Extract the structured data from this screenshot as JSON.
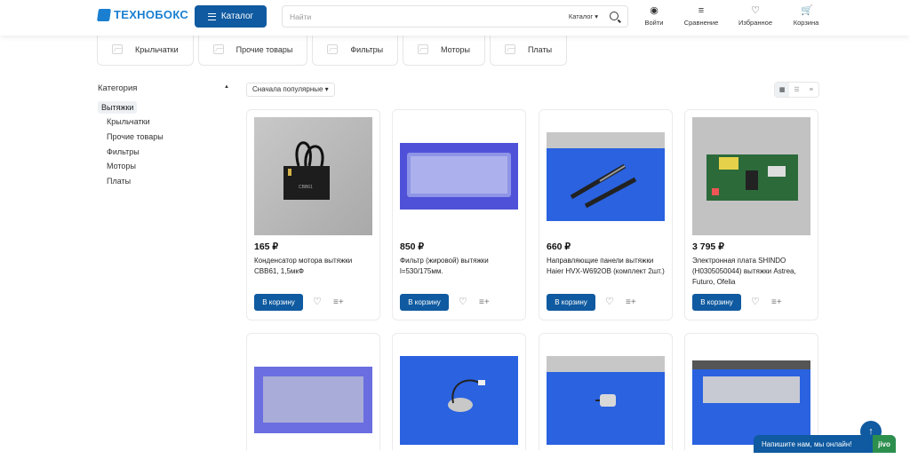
{
  "header": {
    "logo": "ТЕХНОБОКС",
    "catalog_button": "Каталог",
    "search_placeholder": "Найти",
    "search_scope": "Каталог",
    "login": "Войти",
    "compare": "Сравнение",
    "favorites": "Избранное",
    "cart": "Корзина"
  },
  "chips": [
    "Крыльчатки",
    "Прочие товары",
    "Фильтры",
    "Моторы",
    "Платы"
  ],
  "sidebar": {
    "title": "Категория",
    "active": "Вытяжки",
    "items": [
      "Крыльчатки",
      "Прочие товары",
      "Фильтры",
      "Моторы",
      "Платы"
    ]
  },
  "sort": {
    "label": "Сначала популярные"
  },
  "products": [
    {
      "price": "165 ₽",
      "title": "Конденсатор мотора вытяжки CBB61, 1,5мкФ",
      "buy": "В корзину"
    },
    {
      "price": "850 ₽",
      "title": "Фильтр (жировой) вытяжки l=530/175мм.",
      "buy": "В корзину"
    },
    {
      "price": "660 ₽",
      "title": "Направляющие панели вытяжки Haier HVX-W692OB (комплект 2шт.)",
      "buy": "В корзину"
    },
    {
      "price": "3 795 ₽",
      "title": "Электронная плата SHINDO (H0305050044) вытяжки Astrea, Futuro, Ofelia",
      "buy": "В корзину"
    }
  ],
  "chat": {
    "text": "Напишите нам, мы онлайн!",
    "brand": "jivo"
  },
  "colors": {
    "accent": "#0f5aa0",
    "logo": "#1a7fd0",
    "jivo": "#2d8f4e"
  }
}
